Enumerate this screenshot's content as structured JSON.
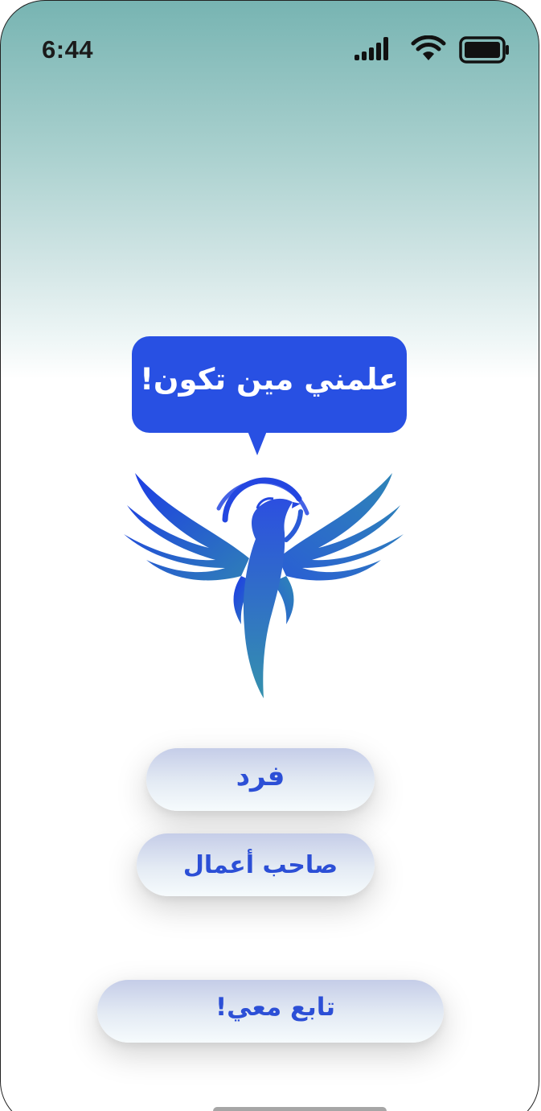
{
  "status_bar": {
    "time": "6:44",
    "icons": [
      "cellular-signal-icon",
      "wifi-icon",
      "battery-icon"
    ]
  },
  "speech_bubble": {
    "text": "علمني مين تكون!"
  },
  "logo": {
    "icon": "phoenix-logo-icon"
  },
  "options": {
    "individual_label": "فرد",
    "business_owner_label": "صاحب أعمال"
  },
  "follow_button": {
    "label": "تابع معي!"
  },
  "colors": {
    "accent": "#2850e3",
    "button_text": "#2c4fd6",
    "header_gradient_top": "#77b4b2",
    "background": "#ffffff"
  }
}
